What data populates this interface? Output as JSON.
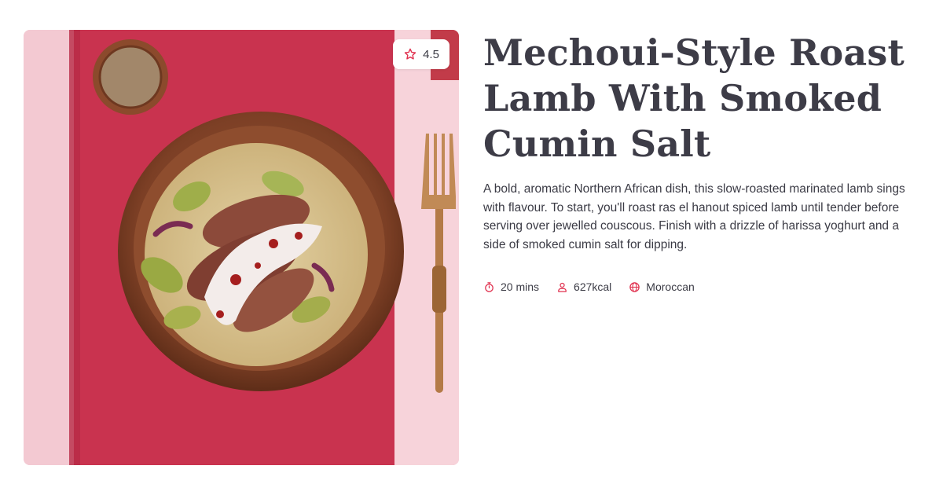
{
  "recipe": {
    "title": "Mechoui-Style Roast Lamb With Smoked Cumin Salt",
    "description": "A bold, aromatic Northern African dish, this slow-roasted marinated lamb sings with flavour. To start, you'll roast ras el hanout spiced lamb until tender before serving over jewelled couscous. Finish with a drizzle of harissa yoghurt and a side of smoked cumin salt for dipping.",
    "rating": "4.5",
    "meta": {
      "time": "20 mins",
      "calories": "627kcal",
      "cuisine": "Moroccan"
    }
  },
  "icons": {
    "rating": "star-icon",
    "time": "stopwatch-icon",
    "calories": "person-icon",
    "cuisine": "globe-icon"
  },
  "colors": {
    "accent": "#e0314f",
    "text": "#3b3b45",
    "runner": "#c9334f",
    "background_pink": "#f2c6cf"
  }
}
